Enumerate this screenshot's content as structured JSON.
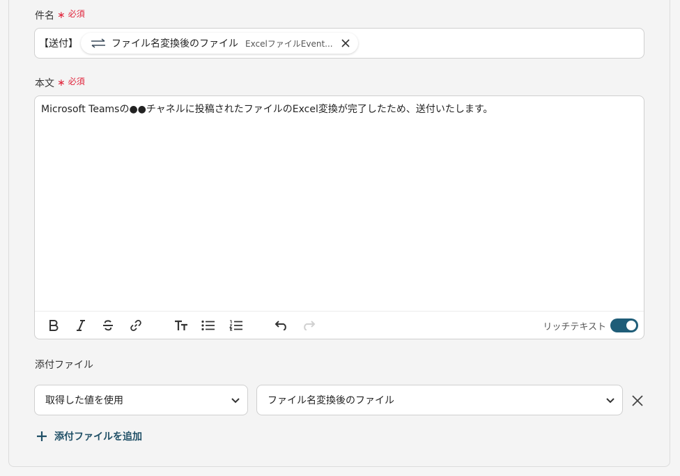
{
  "subject": {
    "label": "件名",
    "required_star": "∗",
    "required_text": "必須",
    "prefix": "【送付】",
    "chip": {
      "label": "ファイル名変換後のファイル",
      "source": "ExcelファイルEvent...",
      "icon": "swap-arrows-icon"
    }
  },
  "body": {
    "label": "本文",
    "required_star": "∗",
    "required_text": "必須",
    "text": "Microsoft Teamsの●●チャネルに投稿されたファイルのExcel変換が完了したため、送付いたします。",
    "toolbar": {
      "buttons": [
        "bold-icon",
        "italic-icon",
        "strikethrough-icon",
        "link-icon",
        "text-size-icon",
        "bullet-list-icon",
        "numbered-list-icon",
        "undo-icon",
        "redo-icon"
      ],
      "rich_text_label": "リッチテキスト",
      "rich_text_enabled": true
    }
  },
  "attachment": {
    "label": "添付ファイル",
    "mode_select": "取得した値を使用",
    "value_select": "ファイル名変換後のファイル",
    "add_label": "添付ファイルを追加"
  },
  "colors": {
    "accent": "#1f5d78",
    "required": "#e0243b",
    "link": "#1f4f66"
  }
}
